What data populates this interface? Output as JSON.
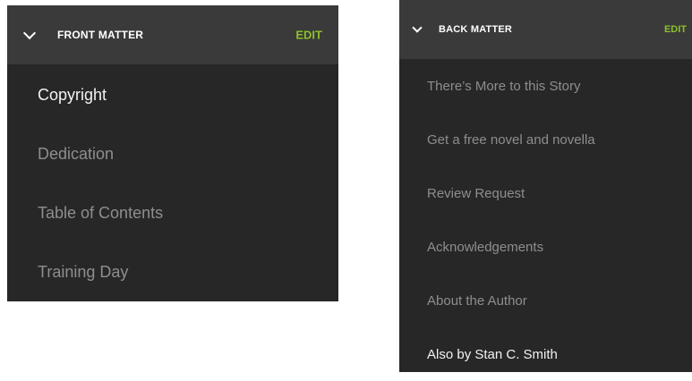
{
  "front_matter": {
    "title": "FRONT MATTER",
    "edit_label": "EDIT",
    "items": [
      {
        "label": "Copyright",
        "active": true
      },
      {
        "label": "Dedication",
        "active": false
      },
      {
        "label": "Table of Contents",
        "active": false
      },
      {
        "label": "Training Day",
        "active": false
      }
    ]
  },
  "back_matter": {
    "title": "BACK MATTER",
    "edit_label": "EDIT",
    "items": [
      {
        "label": "There’s More to this Story",
        "active": false
      },
      {
        "label": "Get a free novel and novella",
        "active": false
      },
      {
        "label": "Review Request",
        "active": false
      },
      {
        "label": "Acknowledgements",
        "active": false
      },
      {
        "label": "About the Author",
        "active": false
      },
      {
        "label": "Also by Stan C. Smith",
        "active": true
      }
    ]
  },
  "colors": {
    "panel_bg": "#272727",
    "header_bg": "#3a3a3a",
    "accent": "#8cbf2a",
    "item_text": "#8e8e8e",
    "active_text": "#f2f2f2"
  },
  "icons": {
    "collapse": "chevron-down-icon"
  }
}
